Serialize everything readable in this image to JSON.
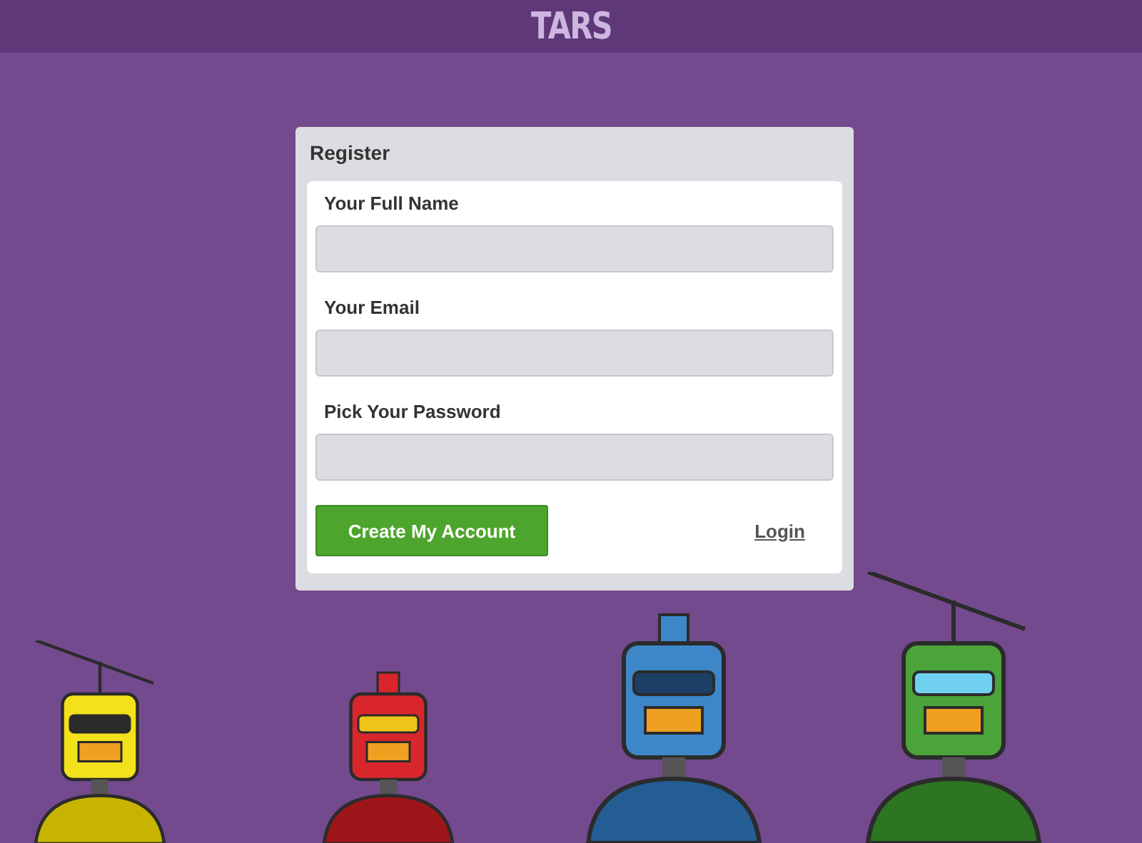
{
  "header": {
    "title": "TARS"
  },
  "register": {
    "title": "Register",
    "fields": [
      {
        "label": "Your Full Name"
      },
      {
        "label": "Your Email"
      },
      {
        "label": "Pick Your Password"
      }
    ],
    "submit_button": "Create My Account",
    "login_link": "Login"
  }
}
